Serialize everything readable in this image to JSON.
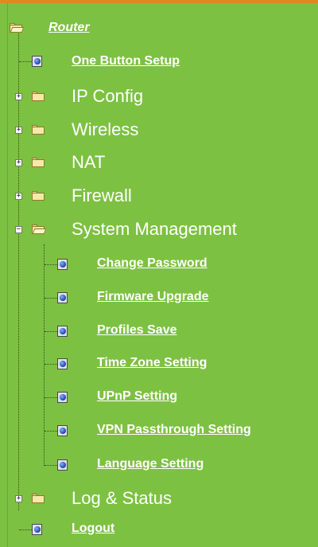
{
  "tree": {
    "root": {
      "label": "Router"
    },
    "items": [
      {
        "label": "One Button Setup",
        "type": "page"
      },
      {
        "label": "IP Config",
        "type": "folder",
        "expanded": false
      },
      {
        "label": "Wireless",
        "type": "folder",
        "expanded": false
      },
      {
        "label": "NAT",
        "type": "folder",
        "expanded": false
      },
      {
        "label": "Firewall",
        "type": "folder",
        "expanded": false
      },
      {
        "label": "System Management",
        "type": "folder",
        "expanded": true,
        "children": [
          {
            "label": "Change Password"
          },
          {
            "label": "Firmware Upgrade"
          },
          {
            "label": "Profiles Save"
          },
          {
            "label": "Time Zone Setting"
          },
          {
            "label": "UPnP Setting"
          },
          {
            "label": "VPN Passthrough Setting"
          },
          {
            "label": "Language Setting"
          }
        ]
      },
      {
        "label": "Log & Status",
        "type": "folder",
        "expanded": false
      },
      {
        "label": "Logout",
        "type": "page"
      }
    ]
  },
  "colors": {
    "background": "#7dc142",
    "text": "#ffffff",
    "accent_bar": "#e08a1e"
  }
}
